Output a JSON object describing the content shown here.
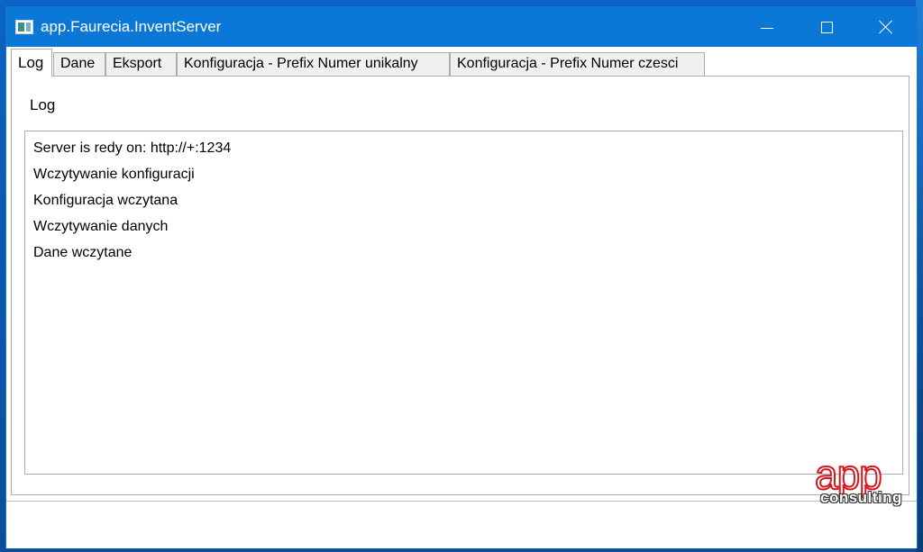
{
  "window": {
    "title": "app.Faurecia.InventServer"
  },
  "tabs": [
    {
      "label": "Log",
      "active": true
    },
    {
      "label": "Dane",
      "active": false
    },
    {
      "label": "Eksport",
      "active": false
    },
    {
      "label": "Konfiguracja - Prefix Numer unikalny",
      "active": false
    },
    {
      "label": "Konfiguracja - Prefix Numer czesci",
      "active": false
    }
  ],
  "log_panel": {
    "label": "Log",
    "lines": [
      "Server is redy on: http://+:1234",
      "Wczytywanie konfiguracji",
      "Konfiguracja wczytana",
      "Wczytywanie danych",
      "Dane wczytane"
    ]
  },
  "logo": {
    "app_text": "app",
    "consulting_text": "consulting",
    "brand_color": "#d9141b"
  },
  "colors": {
    "titlebar": "#0b78d7",
    "desktop": "#0b63c4"
  },
  "icons": {
    "app": "app-window-icon",
    "minimize": "minimize-icon",
    "maximize": "maximize-icon",
    "close": "close-icon"
  }
}
